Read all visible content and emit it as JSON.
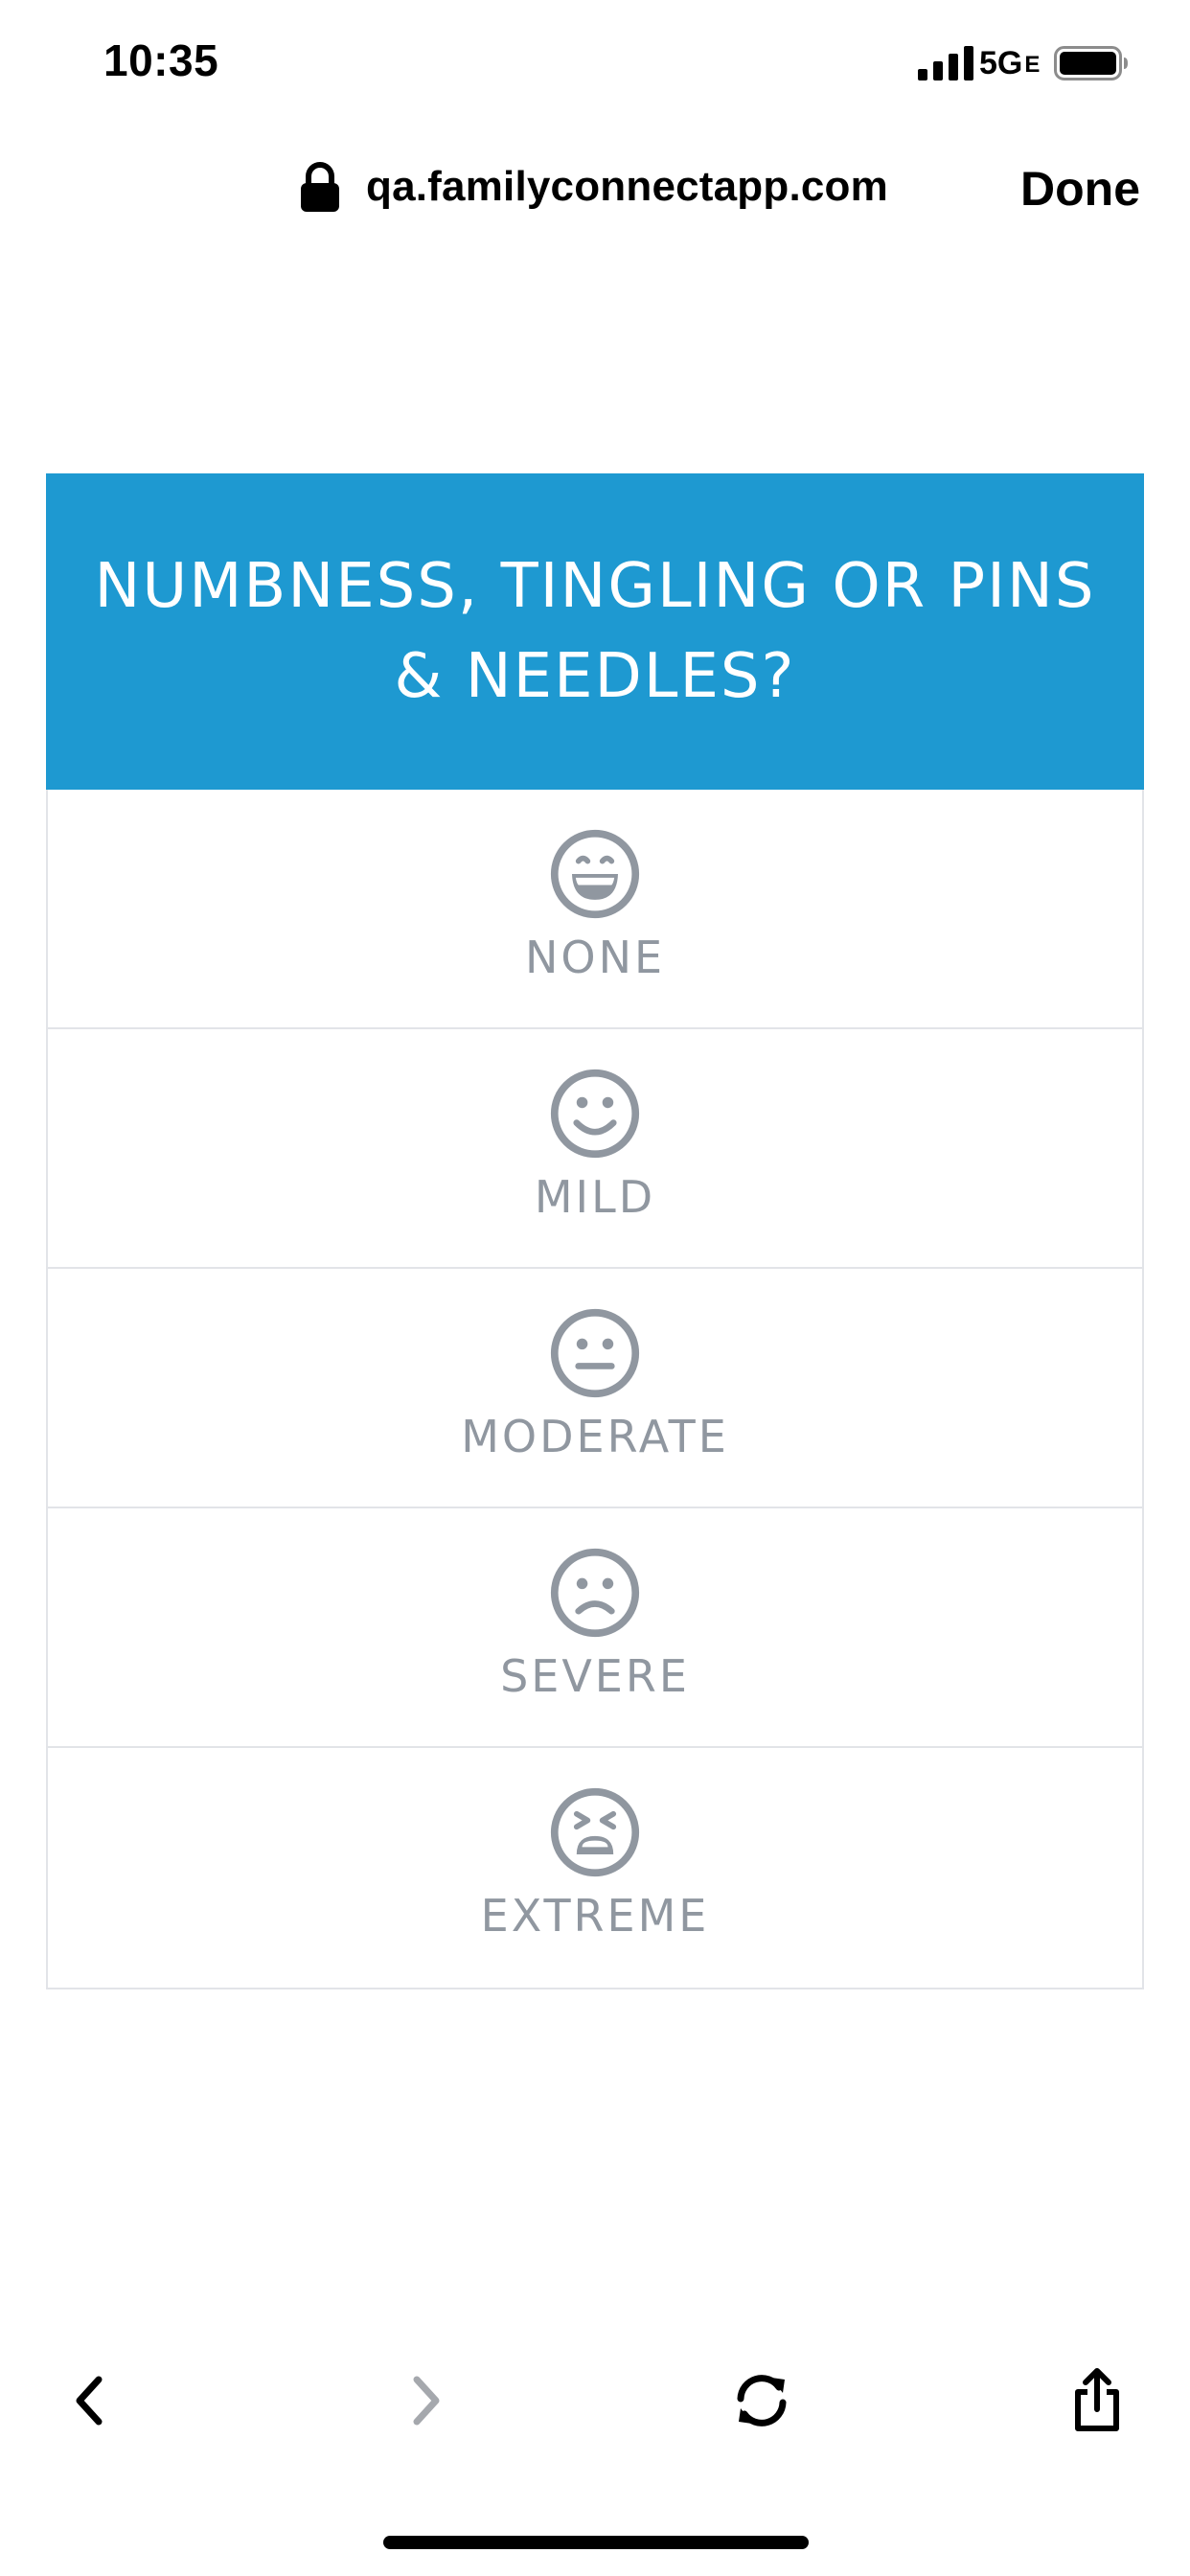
{
  "status_bar": {
    "time": "10:35",
    "network": "5G",
    "network_suffix": "E"
  },
  "browser": {
    "url": "qa.familyconnectapp.com",
    "done_label": "Done"
  },
  "question": {
    "title": "NUMBNESS, TINGLING OR PINS & NEEDLES?",
    "header_color": "#1e99d1",
    "options": [
      {
        "label": "NONE",
        "icon": "grinning-face-icon"
      },
      {
        "label": "MILD",
        "icon": "smiling-face-icon"
      },
      {
        "label": "MODERATE",
        "icon": "neutral-face-icon"
      },
      {
        "label": "SEVERE",
        "icon": "frowning-face-icon"
      },
      {
        "label": "EXTREME",
        "icon": "tired-face-icon"
      }
    ]
  },
  "toolbar": {
    "icons": [
      "back-icon",
      "forward-icon",
      "reload-icon",
      "share-icon"
    ]
  }
}
